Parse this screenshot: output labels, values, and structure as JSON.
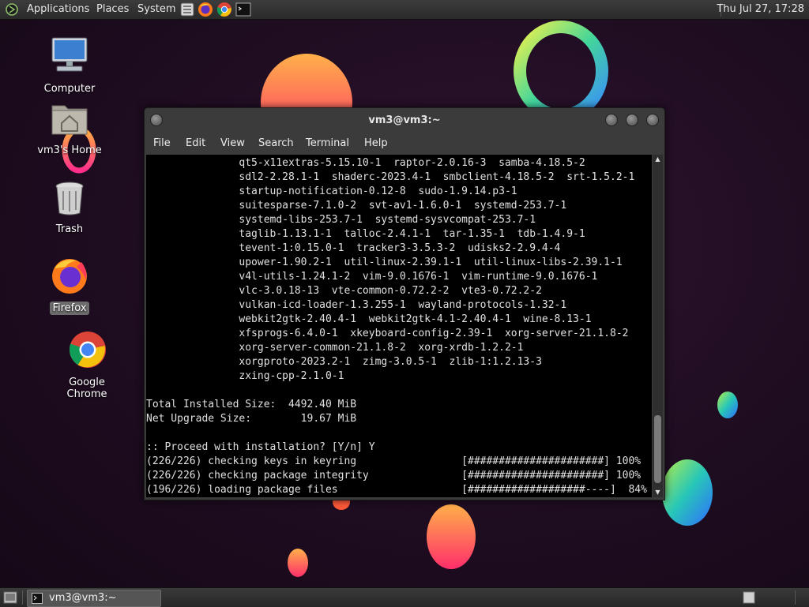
{
  "top_panel": {
    "menus": [
      "Applications",
      "Places",
      "System"
    ],
    "clock": "Thu Jul 27, 17:28"
  },
  "desktop": {
    "icons": [
      {
        "label": "Computer",
        "icon": "computer-icon"
      },
      {
        "label": "vm3's Home",
        "icon": "home-folder-icon"
      },
      {
        "label": "Trash",
        "icon": "trash-icon"
      },
      {
        "label": "Firefox",
        "icon": "firefox-icon"
      },
      {
        "label": "Google Chrome",
        "icon": "chrome-icon"
      }
    ]
  },
  "window": {
    "title": "vm3@vm3:~",
    "menu": [
      "File",
      "Edit",
      "View",
      "Search",
      "Terminal",
      "Help"
    ],
    "terminal_lines": [
      "               qt5-x11extras-5.15.10-1  raptor-2.0.16-3  samba-4.18.5-2",
      "               sdl2-2.28.1-1  shaderc-2023.4-1  smbclient-4.18.5-2  srt-1.5.2-1",
      "               startup-notification-0.12-8  sudo-1.9.14.p3-1",
      "               suitesparse-7.1.0-2  svt-av1-1.6.0-1  systemd-253.7-1",
      "               systemd-libs-253.7-1  systemd-sysvcompat-253.7-1",
      "               taglib-1.13.1-1  talloc-2.4.1-1  tar-1.35-1  tdb-1.4.9-1",
      "               tevent-1:0.15.0-1  tracker3-3.5.3-2  udisks2-2.9.4-4",
      "               upower-1.90.2-1  util-linux-2.39.1-1  util-linux-libs-2.39.1-1",
      "               v4l-utils-1.24.1-2  vim-9.0.1676-1  vim-runtime-9.0.1676-1",
      "               vlc-3.0.18-13  vte-common-0.72.2-2  vte3-0.72.2-2",
      "               vulkan-icd-loader-1.3.255-1  wayland-protocols-1.32-1",
      "               webkit2gtk-2.40.4-1  webkit2gtk-4.1-2.40.4-1  wine-8.13-1",
      "               xfsprogs-6.4.0-1  xkeyboard-config-2.39-1  xorg-server-21.1.8-2",
      "               xorg-server-common-21.1.8-2  xorg-xrdb-1.2.2-1",
      "               xorgproto-2023.2-1  zimg-3.0.5-1  zlib-1:1.2.13-3",
      "               zxing-cpp-2.1.0-1",
      "",
      "Total Installed Size:  4492.40 MiB",
      "Net Upgrade Size:        19.67 MiB",
      "",
      ":: Proceed with installation? [Y/n] Y",
      "(226/226) checking keys in keyring                 [######################] 100%",
      "(226/226) checking package integrity               [######################] 100%",
      "(196/226) loading package files                    [###################----]  84%"
    ]
  },
  "bottom_panel": {
    "task_label": "vm3@vm3:~"
  }
}
